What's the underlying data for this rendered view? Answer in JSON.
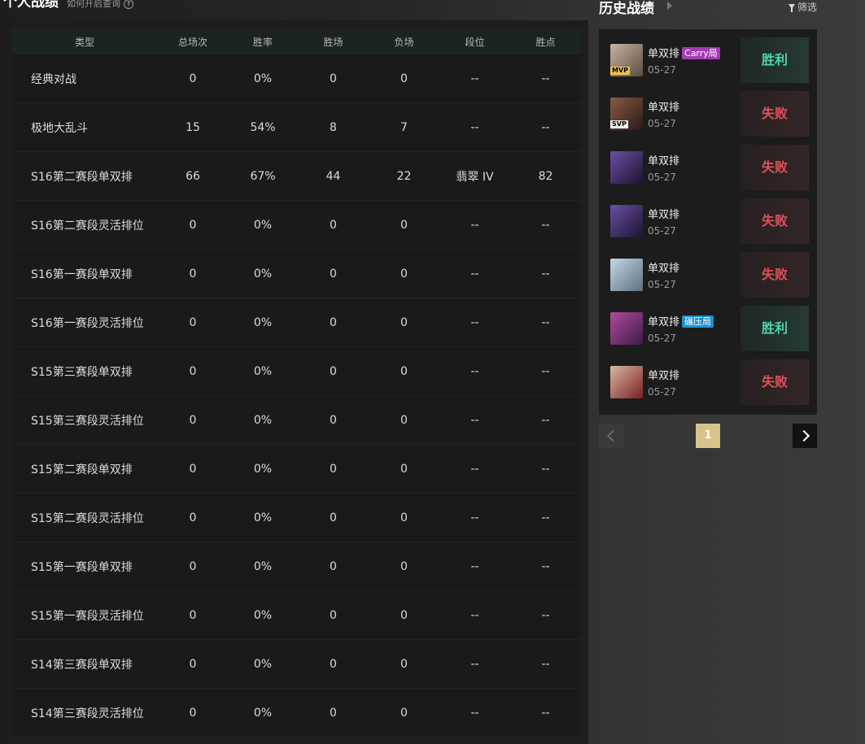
{
  "left": {
    "title": "个人战绩",
    "subtitle": "如何开启查询"
  },
  "table": {
    "headers": [
      "类型",
      "总场次",
      "胜率",
      "胜场",
      "负场",
      "段位",
      "胜点"
    ],
    "rows": [
      [
        "经典对战",
        "0",
        "0%",
        "0",
        "0",
        "--",
        "--"
      ],
      [
        "极地大乱斗",
        "15",
        "54%",
        "8",
        "7",
        "--",
        "--"
      ],
      [
        "S16第二赛段单双排",
        "66",
        "67%",
        "44",
        "22",
        "翡翠 IV",
        "82"
      ],
      [
        "S16第二赛段灵活排位",
        "0",
        "0%",
        "0",
        "0",
        "--",
        "--"
      ],
      [
        "S16第一赛段单双排",
        "0",
        "0%",
        "0",
        "0",
        "--",
        "--"
      ],
      [
        "S16第一赛段灵活排位",
        "0",
        "0%",
        "0",
        "0",
        "--",
        "--"
      ],
      [
        "S15第三赛段单双排",
        "0",
        "0%",
        "0",
        "0",
        "--",
        "--"
      ],
      [
        "S15第三赛段灵活排位",
        "0",
        "0%",
        "0",
        "0",
        "--",
        "--"
      ],
      [
        "S15第二赛段单双排",
        "0",
        "0%",
        "0",
        "0",
        "--",
        "--"
      ],
      [
        "S15第二赛段灵活排位",
        "0",
        "0%",
        "0",
        "0",
        "--",
        "--"
      ],
      [
        "S15第一赛段单双排",
        "0",
        "0%",
        "0",
        "0",
        "--",
        "--"
      ],
      [
        "S15第一赛段灵活排位",
        "0",
        "0%",
        "0",
        "0",
        "--",
        "--"
      ],
      [
        "S14第三赛段单双排",
        "0",
        "0%",
        "0",
        "0",
        "--",
        "--"
      ],
      [
        "S14第三赛段灵活排位",
        "0",
        "0%",
        "0",
        "0",
        "--",
        "--"
      ]
    ]
  },
  "history": {
    "title": "历史战绩",
    "filter_label": "筛选",
    "matches": [
      {
        "mode": "单双排",
        "tag": "Carry局",
        "tag_color": "#a53bb5",
        "date": "05-27",
        "result": "胜利",
        "outcome": "win",
        "badge": "MVP",
        "colors": [
          "#c9b3a0",
          "#5a4c42"
        ]
      },
      {
        "mode": "单双排",
        "tag": "",
        "tag_color": "",
        "date": "05-27",
        "result": "失败",
        "outcome": "lose",
        "badge": "SVP",
        "colors": [
          "#8a5a45",
          "#2a1a18"
        ]
      },
      {
        "mode": "单双排",
        "tag": "",
        "tag_color": "",
        "date": "05-27",
        "result": "失败",
        "outcome": "lose",
        "badge": "",
        "colors": [
          "#6a4fa3",
          "#1c1430"
        ]
      },
      {
        "mode": "单双排",
        "tag": "",
        "tag_color": "",
        "date": "05-27",
        "result": "失败",
        "outcome": "lose",
        "badge": "",
        "colors": [
          "#6a4fa3",
          "#1c1430"
        ]
      },
      {
        "mode": "单双排",
        "tag": "",
        "tag_color": "",
        "date": "05-27",
        "result": "失败",
        "outcome": "lose",
        "badge": "",
        "colors": [
          "#c4d8e6",
          "#5b7080"
        ]
      },
      {
        "mode": "单双排",
        "tag": "碾压局",
        "tag_color": "#1f8fd0",
        "date": "05-27",
        "result": "胜利",
        "outcome": "win",
        "badge": "",
        "colors": [
          "#b24a9a",
          "#3a1d4a"
        ]
      },
      {
        "mode": "单双排",
        "tag": "",
        "tag_color": "",
        "date": "05-27",
        "result": "失败",
        "outcome": "lose",
        "badge": "",
        "colors": [
          "#d9b9a4",
          "#7a2020"
        ]
      }
    ]
  },
  "pager": {
    "current_page": "1"
  },
  "colors": {
    "win": "#4fd5b0",
    "lose": "#e0515a",
    "accent_page": "#d8c38a"
  }
}
